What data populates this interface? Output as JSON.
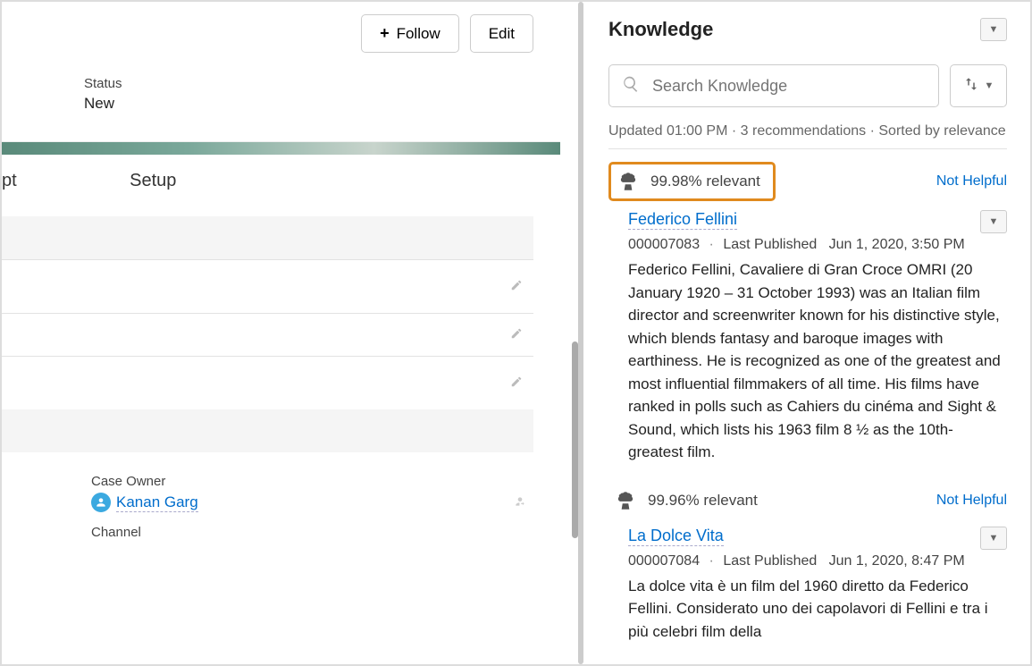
{
  "left": {
    "follow_label": "Follow",
    "edit_label": "Edit",
    "status_label": "Status",
    "status_value": "New",
    "tab1": "pt",
    "tab2": "Setup",
    "case_owner_label": "Case Owner",
    "case_owner_name": "Kanan Garg",
    "channel_label": "Channel"
  },
  "knowledge": {
    "title": "Knowledge",
    "search_placeholder": "Search Knowledge",
    "meta": "Updated 01:00 PM · 3 recommendations · Sorted by relevance",
    "articles": [
      {
        "relevance": "99.98% relevant",
        "not_helpful": "Not Helpful",
        "title": "Federico Fellini",
        "id": "000007083",
        "published_label": "Last Published",
        "published_date": "Jun 1, 2020, 3:50 PM",
        "description": "Federico Fellini, Cavaliere di Gran Croce OMRI (20 January 1920 – 31 October 1993) was an Italian film director and screenwriter known for his distinctive style, which blends fantasy and baroque images with earthiness. He is recognized as one of the greatest and most influential filmmakers of all time. His films have ranked in polls such as Cahiers du cinéma and Sight & Sound, which lists his 1963 film 8 ½ as the 10th-greatest film.",
        "highlighted": true
      },
      {
        "relevance": "99.96% relevant",
        "not_helpful": "Not Helpful",
        "title": "La Dolce Vita",
        "id": "000007084",
        "published_label": "Last Published",
        "published_date": "Jun 1, 2020, 8:47 PM",
        "description": "La dolce vita è un film del 1960 diretto da Federico Fellini. Considerato uno dei capolavori di Fellini e tra i più celebri film della",
        "highlighted": false
      }
    ]
  }
}
